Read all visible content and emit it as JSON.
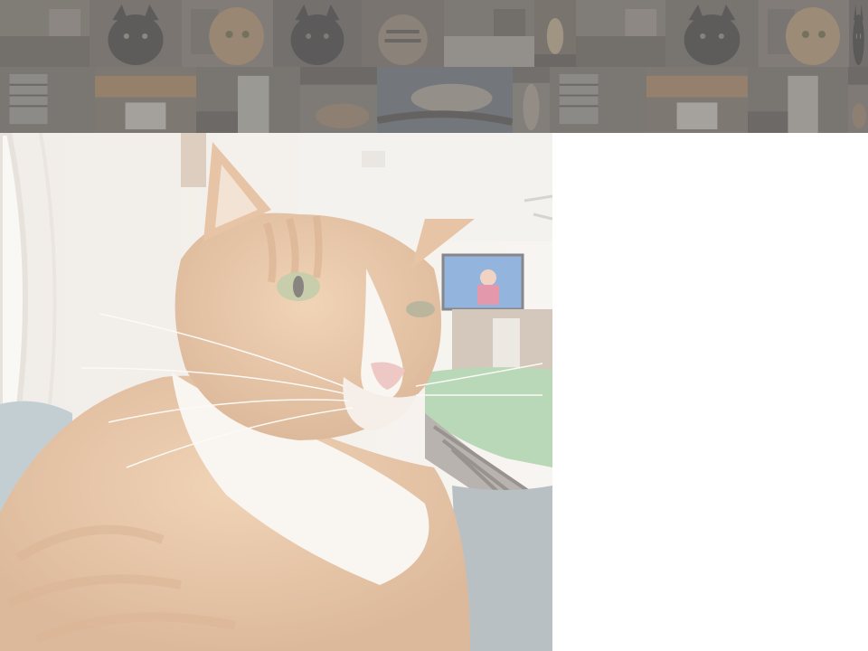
{
  "gallery": {
    "row1": [
      {
        "scene": "room-bed",
        "colors": [
          "#8b8074",
          "#6d645c",
          "#a59a8e"
        ]
      },
      {
        "scene": "cat-face-black",
        "colors": [
          "#7c7268",
          "#3f3b38",
          "#a8998a"
        ]
      },
      {
        "scene": "cat-face-orange",
        "colors": [
          "#8d8276",
          "#c29a6e",
          "#6f6a66"
        ]
      },
      {
        "scene": "cat-face-black",
        "colors": [
          "#6e665f",
          "#3a3735",
          "#8d7f73"
        ]
      },
      {
        "scene": "cat-face-tabby",
        "colors": [
          "#7a7066",
          "#a28f7c",
          "#5a534e"
        ]
      },
      {
        "scene": "room-bed",
        "colors": [
          "#837a71",
          "#b4aca2",
          "#6a625a"
        ]
      },
      {
        "scene": "cat-small",
        "colors": [
          "#7b6f63",
          "#d1b78f",
          "#5b544e"
        ]
      },
      {
        "scene": "room-bed",
        "colors": [
          "#8a8177",
          "#6e665e",
          "#a69c91"
        ]
      },
      {
        "scene": "cat-face-black",
        "colors": [
          "#786f66",
          "#3e3a37",
          "#9b8e80"
        ]
      },
      {
        "scene": "cat-face-orange",
        "colors": [
          "#8c8075",
          "#c8a276",
          "#6f6963"
        ]
      },
      {
        "scene": "cat-face-black",
        "colors": [
          "#6d655e",
          "#393634",
          "#8e8174"
        ]
      }
    ],
    "row2": [
      {
        "scene": "window",
        "colors": [
          "#7d756c",
          "#a7a29b",
          "#5b5550"
        ]
      },
      {
        "scene": "kitchen",
        "colors": [
          "#85786b",
          "#b58a5c",
          "#d9d3c9"
        ]
      },
      {
        "scene": "room-door",
        "colors": [
          "#7a7168",
          "#c6c0b7",
          "#5e5750"
        ]
      },
      {
        "scene": "room-cat",
        "colors": [
          "#867c72",
          "#a68a6a",
          "#5f5852"
        ]
      },
      {
        "scene": "bed-cat",
        "colors": [
          "#6d7782",
          "#b6aa9c",
          "#4f4b48"
        ]
      },
      {
        "scene": "cat-standing",
        "colors": [
          "#8e857b",
          "#b3a797",
          "#6b645d"
        ]
      },
      {
        "scene": "window",
        "colors": [
          "#7e766d",
          "#a5a09a",
          "#5c5651"
        ]
      },
      {
        "scene": "kitchen",
        "colors": [
          "#86796c",
          "#b68b5d",
          "#dbd5cb"
        ]
      },
      {
        "scene": "room-door",
        "colors": [
          "#7b7269",
          "#c7c1b8",
          "#5f5851"
        ]
      },
      {
        "scene": "room-cat",
        "colors": [
          "#877d73",
          "#a78b6b",
          "#605953"
        ]
      }
    ]
  },
  "preview": {
    "subject": "orange-tabby-cat-selfie",
    "colors": {
      "fur": "#d7a070",
      "fur_light": "#ecd2b4",
      "white": "#f6efe8",
      "wall": "#ece7df",
      "tv": "#4f86c9",
      "blanket": "#8fc08c",
      "nose": "#e3a7a0",
      "eye": "#a7b17a"
    }
  }
}
